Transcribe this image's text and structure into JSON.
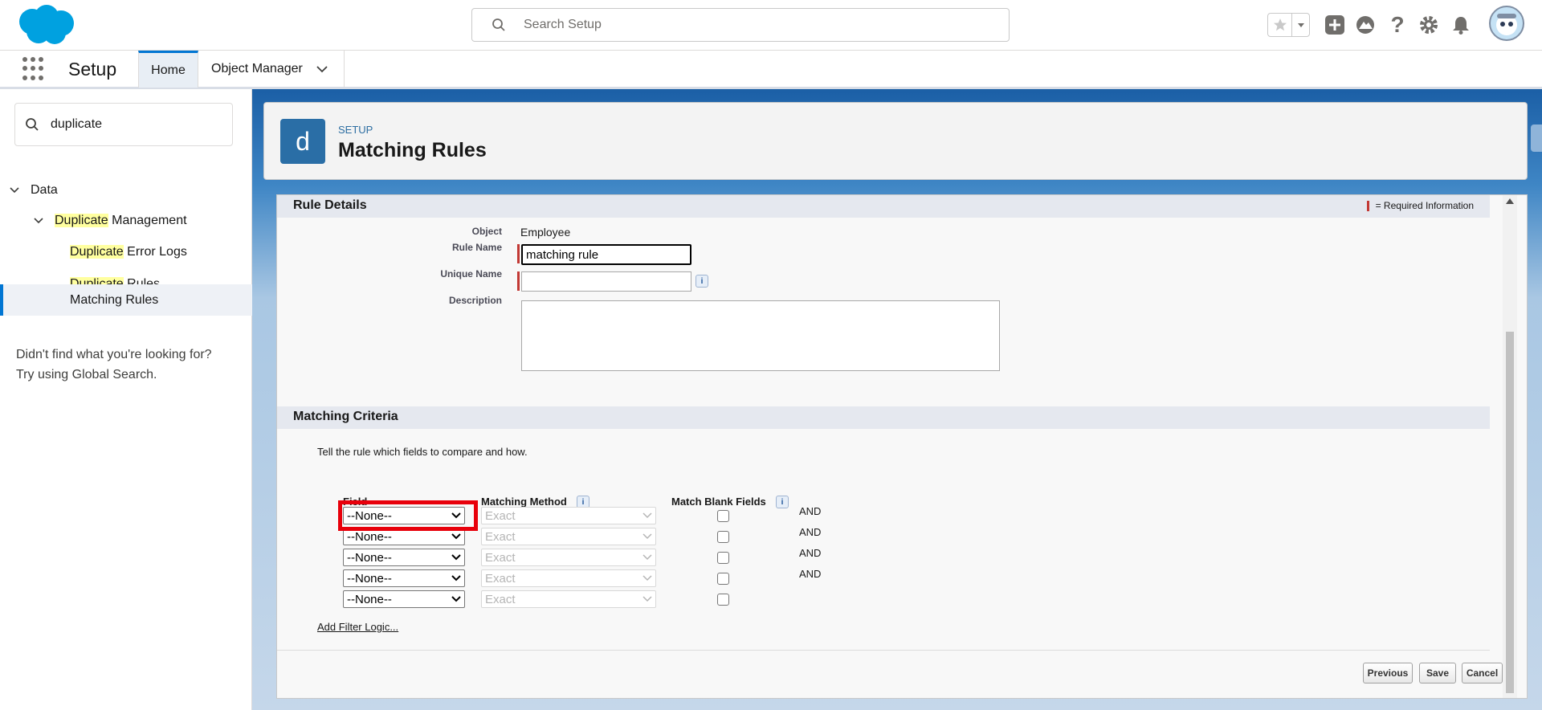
{
  "header": {
    "search_placeholder": "Search Setup",
    "icons": [
      "salesforce-logo",
      "favorites-star-icon",
      "favorites-dropdown-icon",
      "add-icon",
      "trailhead-icon",
      "help-icon",
      "gear-icon",
      "notifications-bell-icon",
      "user-avatar"
    ]
  },
  "nav": {
    "app_name": "Setup",
    "tabs": [
      {
        "label": "Home",
        "active": true
      },
      {
        "label": "Object Manager",
        "active": false
      }
    ]
  },
  "sidebar": {
    "quick_find_value": "duplicate",
    "tree": {
      "data": "Data",
      "duplicate_management": {
        "highlight": "Duplicate",
        "rest": " Management"
      },
      "duplicate_error_logs": {
        "highlight": "Duplicate",
        "rest": " Error Logs"
      },
      "duplicate_rules": {
        "highlight": "Duplicate",
        "rest": " Rules"
      },
      "matching_rules": "Matching Rules"
    },
    "hint_line1": "Didn't find what you're looking for?",
    "hint_line2": "Try using Global Search."
  },
  "page_header": {
    "icon_letter": "d",
    "eyebrow": "SETUP",
    "title": "Matching Rules"
  },
  "form": {
    "rule_details_title": "Rule Details",
    "required_info": "= Required Information",
    "object_label": "Object",
    "object_value": "Employee",
    "rule_name_label": "Rule Name",
    "rule_name_value": "matching rule",
    "unique_name_label": "Unique Name",
    "unique_name_value": "",
    "description_label": "Description",
    "matching_criteria_title": "Matching Criteria",
    "criteria_intro": "Tell the rule which fields to compare and how.",
    "col_field": "Field",
    "col_method": "Matching Method",
    "col_blank": "Match Blank Fields",
    "rows": [
      {
        "field": "--None--",
        "method": "Exact",
        "and": "AND"
      },
      {
        "field": "--None--",
        "method": "Exact",
        "and": "AND"
      },
      {
        "field": "--None--",
        "method": "Exact",
        "and": "AND"
      },
      {
        "field": "--None--",
        "method": "Exact",
        "and": "AND"
      },
      {
        "field": "--None--",
        "method": "Exact",
        "and": ""
      }
    ],
    "add_filter_logic": "Add Filter Logic...",
    "buttons": {
      "previous": "Previous",
      "save": "Save",
      "cancel": "Cancel"
    },
    "info_glyph": "i"
  },
  "colors": {
    "accent": "#0176d3",
    "required": "#c23934",
    "highlight_box": "#e8000b",
    "search_highlight": "#ffff9f"
  }
}
